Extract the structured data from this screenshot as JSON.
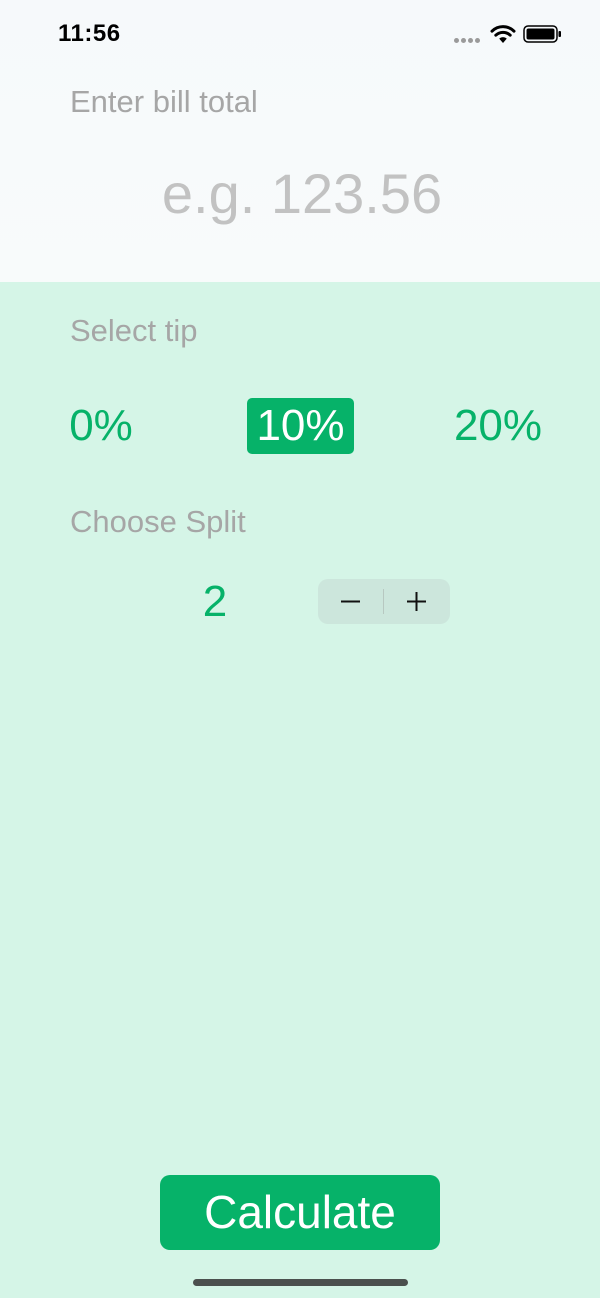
{
  "status_bar": {
    "time": "11:56"
  },
  "bill": {
    "label": "Enter bill total",
    "value": "",
    "placeholder": "e.g. 123.56"
  },
  "tip": {
    "label": "Select tip",
    "options": [
      "0%",
      "10%",
      "20%"
    ],
    "selected": "10%"
  },
  "split": {
    "label": "Choose Split",
    "value": "2",
    "minus": "−",
    "plus": "+"
  },
  "calculate_label": "Calculate",
  "colors": {
    "accent": "#06b269",
    "background": "#d5f5e7",
    "header": "#f7fafb",
    "label": "#a6a6a6"
  }
}
